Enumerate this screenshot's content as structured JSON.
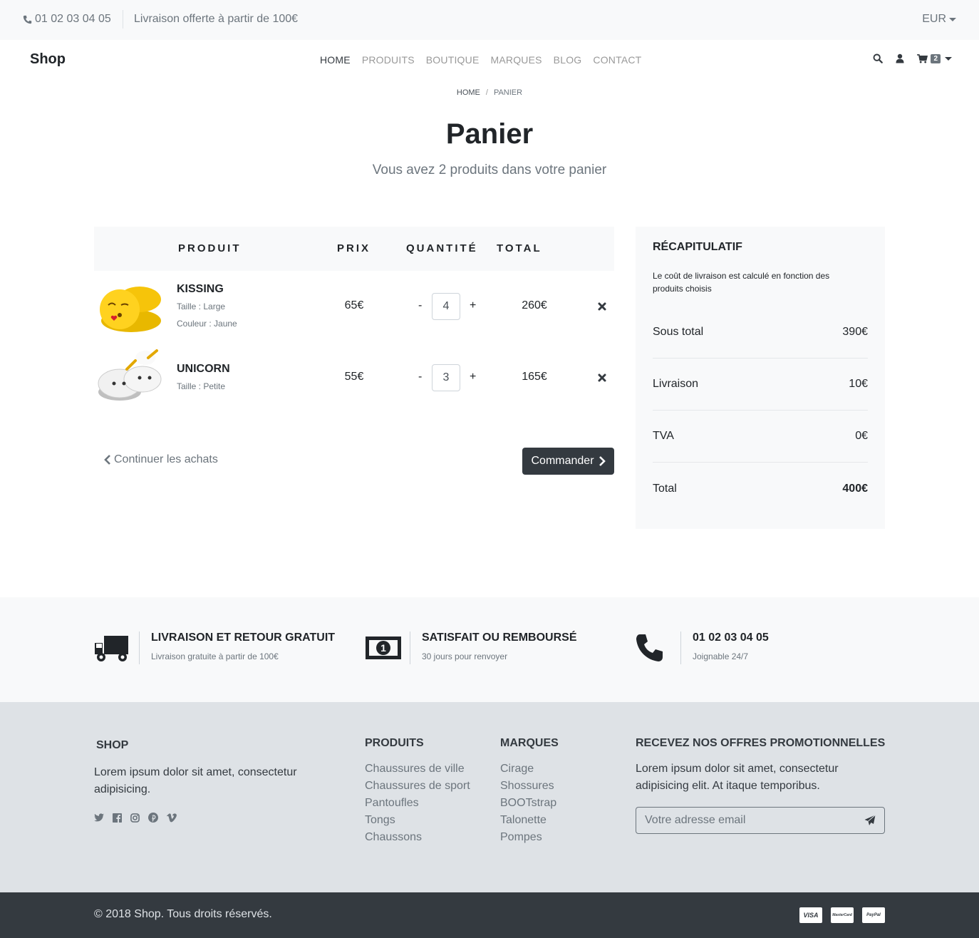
{
  "topbar": {
    "phone": "01 02 03 04 05",
    "promo": "Livraison offerte à partir de 100€",
    "currency": "EUR"
  },
  "navbar": {
    "brand": "Shop",
    "links": [
      "HOME",
      "PRODUITS",
      "BOUTIQUE",
      "MARQUES",
      "BLOG",
      "CONTACT"
    ],
    "active": "HOME",
    "cart_count": "2"
  },
  "breadcrumb": {
    "home": "HOME",
    "separator": "/",
    "current": "PANIER"
  },
  "page": {
    "title": "Panier",
    "subtitle": "Vous avez 2 produits dans votre panier"
  },
  "cart": {
    "headers": {
      "product": "PRODUIT",
      "price": "PRIX",
      "quantity": "QUANTITÉ",
      "total": "TOTAL"
    },
    "items": [
      {
        "name": "KISSING",
        "attr1": "Taille : Large",
        "attr2": "Couleur : Jaune",
        "price": "65€",
        "quantity": "4",
        "total": "260€",
        "image": "yellow-emoji-slipper"
      },
      {
        "name": "UNICORN",
        "attr1": "Taille : Petite",
        "price": "55€",
        "quantity": "3",
        "total": "165€",
        "image": "white-unicorn-slippers"
      }
    ],
    "minus": "-",
    "plus": "+",
    "continue": "Continuer les achats",
    "order": "Commander"
  },
  "summary": {
    "title": "RÉCAPITULATIF",
    "note": "Le coût de livraison est calculé en fonction des produits choisis",
    "subtotal_label": "Sous total",
    "subtotal": "390€",
    "shipping_label": "Livraison",
    "shipping": "10€",
    "tax_label": "TVA",
    "tax": "0€",
    "total_label": "Total",
    "total": "400€"
  },
  "services": [
    {
      "title": "LIVRAISON ET RETOUR GRATUIT",
      "sub": "Livraison gratuite à partir de 100€",
      "icon": "truck-icon"
    },
    {
      "title": "SATISFAIT OU REMBOURSÉ",
      "sub": "30 jours pour renvoyer",
      "icon": "money-icon"
    },
    {
      "title": "01 02 03 04 05",
      "sub": "Joignable 24/7",
      "icon": "phone-icon"
    }
  ],
  "footer": {
    "shop_title": "SHOP",
    "shop_text": "Lorem ipsum dolor sit amet, consectetur adipisicing.",
    "products_title": "PRODUITS",
    "products": [
      "Chaussures de ville",
      "Chaussures de sport",
      "Pantoufles",
      "Tongs",
      "Chaussons"
    ],
    "brands_title": "MARQUES",
    "brands": [
      "Cirage",
      "Shossures",
      "BOOTstrap",
      "Talonette",
      "Pompes"
    ],
    "newsletter_title": "RECEVEZ NOS OFFRES PROMOTIONNELLES",
    "newsletter_text": "Lorem ipsum dolor sit amet, consectetur adipisicing elit. At itaque temporibus.",
    "email_placeholder": "Votre adresse email",
    "socials": [
      "twitter-icon",
      "facebook-icon",
      "instagram-icon",
      "pinterest-icon",
      "vimeo-icon"
    ]
  },
  "copyright": {
    "text": "© 2018   Shop. Tous droits réservés.",
    "cards": [
      "VISA",
      "MasterCard",
      "PayPal"
    ]
  },
  "colors": {
    "dark": "#343a40",
    "light_bg": "#f8f9fa",
    "footer_bg": "#dee2e6",
    "muted": "#6c757d"
  }
}
